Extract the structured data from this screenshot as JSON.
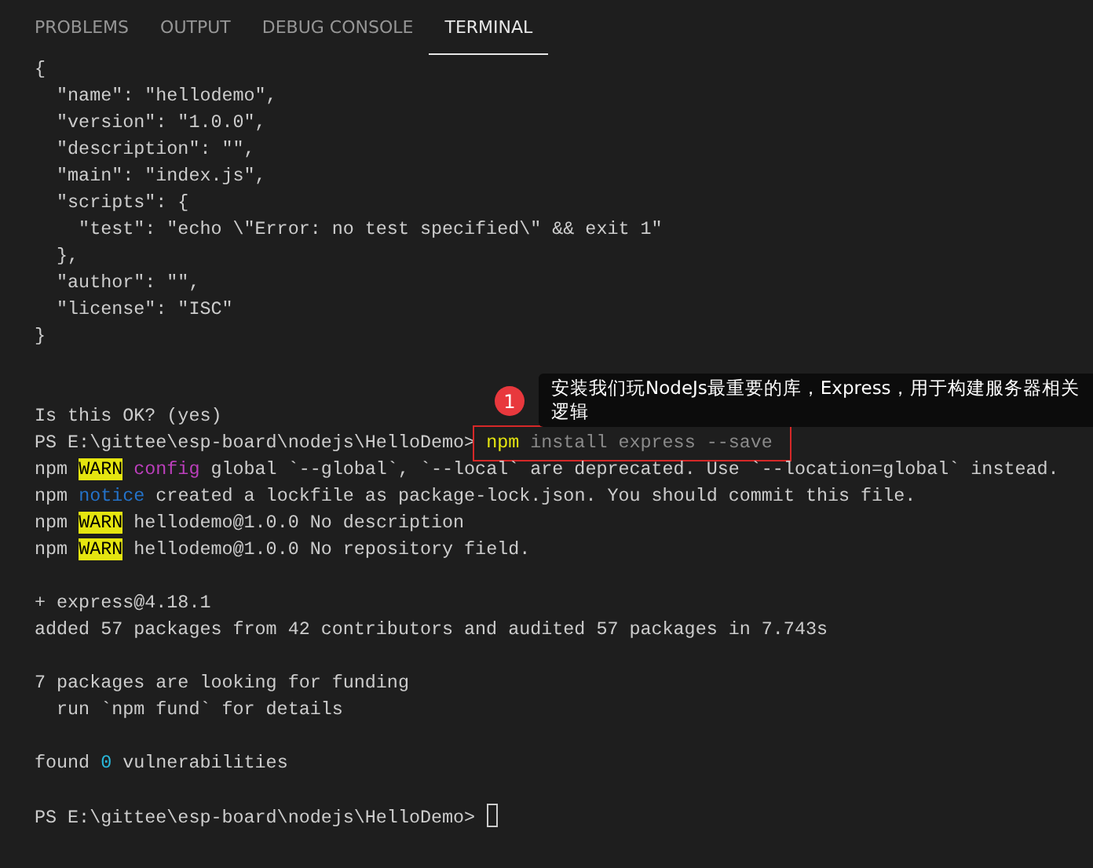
{
  "tabs": [
    {
      "label": "PROBLEMS",
      "selected": false
    },
    {
      "label": "OUTPUT",
      "selected": false
    },
    {
      "label": "DEBUG CONSOLE",
      "selected": false
    },
    {
      "label": "TERMINAL",
      "selected": true
    }
  ],
  "terminal": {
    "lines": [
      {
        "segments": [
          {
            "text": "{",
            "kind": "plain"
          }
        ]
      },
      {
        "segments": [
          {
            "text": "  \"name\": \"hellodemo\",",
            "kind": "plain"
          }
        ]
      },
      {
        "segments": [
          {
            "text": "  \"version\": \"1.0.0\",",
            "kind": "plain"
          }
        ]
      },
      {
        "segments": [
          {
            "text": "  \"description\": \"\",",
            "kind": "plain"
          }
        ]
      },
      {
        "segments": [
          {
            "text": "  \"main\": \"index.js\",",
            "kind": "plain"
          }
        ]
      },
      {
        "segments": [
          {
            "text": "  \"scripts\": {",
            "kind": "plain"
          }
        ]
      },
      {
        "segments": [
          {
            "text": "    \"test\": \"echo \\\"Error: no test specified\\\" && exit 1\"",
            "kind": "plain"
          }
        ]
      },
      {
        "segments": [
          {
            "text": "  },",
            "kind": "plain"
          }
        ]
      },
      {
        "segments": [
          {
            "text": "  \"author\": \"\",",
            "kind": "plain"
          }
        ]
      },
      {
        "segments": [
          {
            "text": "  \"license\": \"ISC\"",
            "kind": "plain"
          }
        ]
      },
      {
        "segments": [
          {
            "text": "}",
            "kind": "plain"
          }
        ]
      },
      {
        "kind": "blank"
      },
      {
        "kind": "blank"
      },
      {
        "segments": [
          {
            "text": "Is this OK? (yes)",
            "kind": "plain"
          }
        ]
      },
      {
        "segments": [
          {
            "text": "PS E:\\gittee\\esp-board\\nodejs\\HelloDemo> ",
            "kind": "plain"
          },
          {
            "text": "npm",
            "kind": "command"
          },
          {
            "text": " install express --save",
            "kind": "argument"
          }
        ]
      },
      {
        "segments": [
          {
            "text": "npm ",
            "kind": "plain"
          },
          {
            "text": "WARN",
            "kind": "warn"
          },
          {
            "text": "config",
            "kind": "config"
          },
          {
            "text": " global `--global`, `--local` are deprecated. Use `--location=global` instead.",
            "kind": "plain"
          }
        ]
      },
      {
        "segments": [
          {
            "text": "npm ",
            "kind": "plain"
          },
          {
            "text": "notice",
            "kind": "notice"
          },
          {
            "text": " created a lockfile as package-lock.json. You should commit this file.",
            "kind": "plain"
          }
        ]
      },
      {
        "segments": [
          {
            "text": "npm ",
            "kind": "plain"
          },
          {
            "text": "WARN",
            "kind": "warn"
          },
          {
            "text": " hellodemo@1.0.0 No description",
            "kind": "plain"
          }
        ]
      },
      {
        "segments": [
          {
            "text": "npm ",
            "kind": "plain"
          },
          {
            "text": "WARN",
            "kind": "warn"
          },
          {
            "text": " hellodemo@1.0.0 No repository field.",
            "kind": "plain"
          }
        ]
      },
      {
        "kind": "blank"
      },
      {
        "segments": [
          {
            "text": "+ express@4.18.1",
            "kind": "plain"
          }
        ]
      },
      {
        "segments": [
          {
            "text": "added 57 packages from 42 contributors and audited 57 packages in 7.743s",
            "kind": "plain"
          }
        ]
      },
      {
        "kind": "blank"
      },
      {
        "segments": [
          {
            "text": "7 packages are looking for funding",
            "kind": "plain"
          }
        ]
      },
      {
        "segments": [
          {
            "text": "  run `npm fund` for details",
            "kind": "plain"
          }
        ]
      },
      {
        "kind": "blank"
      },
      {
        "segments": [
          {
            "text": "found ",
            "kind": "plain"
          },
          {
            "text": "0",
            "kind": "number"
          },
          {
            "text": " vulnerabilities",
            "kind": "plain"
          }
        ]
      },
      {
        "kind": "blank"
      },
      {
        "segments": [
          {
            "text": "PS E:\\gittee\\esp-board\\nodejs\\HelloDemo> ",
            "kind": "plain"
          }
        ],
        "cursor": true
      }
    ]
  },
  "annotation": {
    "number": "1",
    "text": "安装我们玩NodeJs最重要的库，Express，用于构建服务器相关逻辑"
  }
}
